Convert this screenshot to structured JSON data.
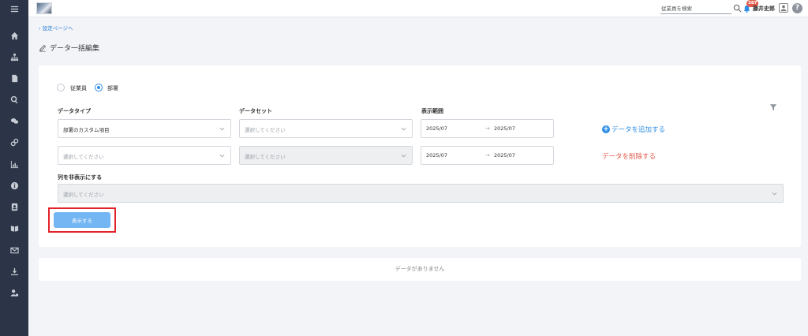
{
  "header": {
    "search_placeholder": "従業員を検索",
    "notification_count": "387",
    "username": "藤井史郎",
    "help_glyph": "?"
  },
  "nav": {
    "back_label": "設定ページへ",
    "page_title": "データ一括編集"
  },
  "filter": {
    "radio_employee": "従業員",
    "radio_department": "部署",
    "selected": "部署",
    "col_data_type": "データタイプ",
    "col_data_set": "データセット",
    "col_display_range": "表示範囲",
    "rows": [
      {
        "data_type": "部署のカスタム項目",
        "data_set": "選択してください",
        "range_from": "2025/07",
        "range_to": "2025/07"
      },
      {
        "data_type": "選択してください",
        "data_set": "選択してください",
        "range_from": "2025/07",
        "range_to": "2025/07"
      }
    ],
    "range_arrow": "→",
    "add_data": "データを追加する",
    "delete_data": "データを削除する",
    "hide_columns_label": "列を非表示にする",
    "hide_columns_placeholder": "選択してください",
    "show_button": "表示する"
  },
  "results": {
    "empty_message": "データがありません"
  },
  "colors": {
    "sidebar": "#2c3547",
    "accent": "#2f8fe6",
    "danger": "#e25a4b",
    "highlight": "#e2242a"
  }
}
